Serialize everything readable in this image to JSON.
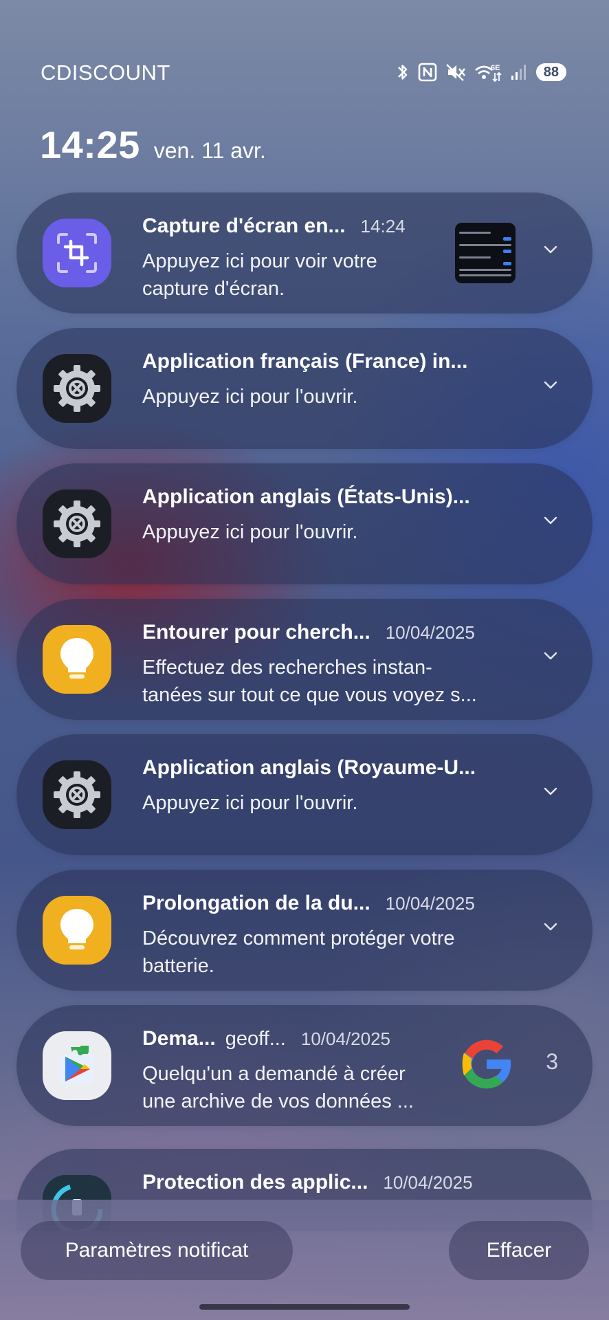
{
  "status_bar": {
    "carrier": "CDISCOUNT",
    "icons": [
      "bluetooth-icon",
      "nfc-icon",
      "mute-icon",
      "wifi-6e-icon",
      "signal-icon"
    ],
    "wifi_label": "6E",
    "battery": "88"
  },
  "clock": {
    "time": "14:25",
    "date": "ven. 11 avr."
  },
  "notifications": [
    {
      "app_icon": "screenshot-icon",
      "title": "Capture d'écran en...",
      "time": "14:24",
      "body_lines": [
        "Appuyez ici pour voir votre",
        "capture d'écran."
      ],
      "has_thumbnail": true
    },
    {
      "app_icon": "settings-gear-icon",
      "title": "Application français (France) in...",
      "time": "",
      "body_lines": [
        "Appuyez ici pour l'ouvrir."
      ]
    },
    {
      "app_icon": "settings-gear-icon",
      "title": "Application anglais (États-Unis)...",
      "time": "",
      "body_lines": [
        "Appuyez ici pour l'ouvrir."
      ]
    },
    {
      "app_icon": "lightbulb-tips-icon",
      "title": "Entourer pour cherch...",
      "time": "10/04/2025",
      "body_lines": [
        "Effectuez des recherches instan-",
        "tanées sur tout ce que vous voyez s..."
      ]
    },
    {
      "app_icon": "settings-gear-icon",
      "title": "Application anglais (Royaume-U...",
      "time": "",
      "body_lines": [
        "Appuyez ici pour l'ouvrir."
      ]
    },
    {
      "app_icon": "lightbulb-tips-icon",
      "title": "Prolongation de la du...",
      "time": "10/04/2025",
      "body_lines": [
        "Découvrez comment protéger votre",
        "batterie."
      ]
    },
    {
      "app_icon": "google-play-services-icon",
      "title": "Dema...",
      "subtitle": "geoff...",
      "time": "10/04/2025",
      "body_lines": [
        "Quelqu'un a demandé à créer",
        "une archive de vos données ..."
      ],
      "count": "3",
      "large_icon": "google-g-icon"
    },
    {
      "app_icon": "device-care-icon",
      "title": "Protection des applic...",
      "time": "10/04/2025",
      "body_lines": []
    }
  ],
  "buttons": {
    "settings": "Paramètres notificat",
    "clear": "Effacer"
  },
  "colors": {
    "capture_icon_bg": "#6a5ee8",
    "gear_icon_bg": "#1c1e25",
    "tips_icon_bg": "#f0b020"
  }
}
